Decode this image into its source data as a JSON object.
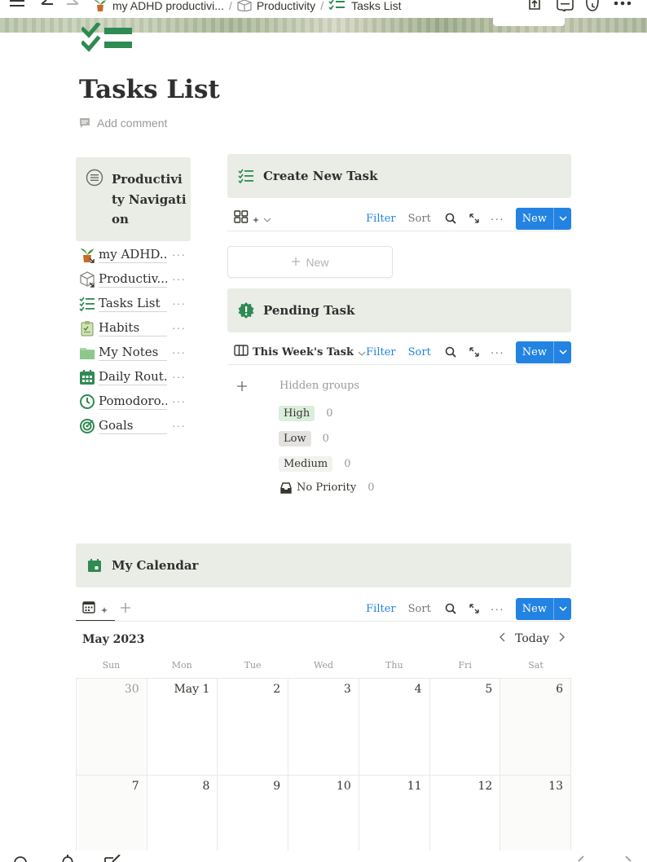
{
  "breadcrumb": {
    "items": [
      "my ADHD productivi...",
      "Productivity",
      "Tasks List"
    ],
    "separator": "/"
  },
  "page": {
    "title": "Tasks List",
    "add_comment": "Add comment"
  },
  "navigation": {
    "title": "Productivity Navigation",
    "items": [
      {
        "label": "my ADHD...",
        "icon": "potted-plant-icon"
      },
      {
        "label": "Productiv...",
        "icon": "cube-icon"
      },
      {
        "label": "Tasks List",
        "icon": "checklist-icon"
      },
      {
        "label": "Habits",
        "icon": "clipboard-icon"
      },
      {
        "label": "My Notes",
        "icon": "folder-icon"
      },
      {
        "label": "Daily Rout...",
        "icon": "calendar-icon"
      },
      {
        "label": "Pomodoro...",
        "icon": "clock-icon"
      },
      {
        "label": "Goals",
        "icon": "target-icon"
      }
    ],
    "more": "···"
  },
  "create_task": {
    "title": "Create New Task",
    "toolbar": {
      "filter": "Filter",
      "sort": "Sort",
      "new": "New",
      "more": "···"
    },
    "add_card": "New"
  },
  "pending_task": {
    "title": "Pending Task",
    "view_name": "This Week's Task",
    "toolbar": {
      "filter": "Filter",
      "sort": "Sort",
      "new": "New",
      "more": "···"
    },
    "hidden_groups": "Hidden groups",
    "groups": [
      {
        "label": "High",
        "count": "0"
      },
      {
        "label": "Low",
        "count": "0"
      },
      {
        "label": "Medium",
        "count": "0"
      },
      {
        "label": "No Priority",
        "count": "0"
      }
    ]
  },
  "calendar": {
    "title": "My Calendar",
    "toolbar": {
      "filter": "Filter",
      "sort": "Sort",
      "new": "New",
      "more": "···"
    },
    "month": "May 2023",
    "today": "Today",
    "weekdays": [
      "Sun",
      "Mon",
      "Tue",
      "Wed",
      "Thu",
      "Fri",
      "Sat"
    ],
    "days": [
      "30",
      "May 1",
      "2",
      "3",
      "4",
      "5",
      "6",
      "7",
      "8",
      "9",
      "10",
      "11",
      "12",
      "13"
    ]
  },
  "colors": {
    "accent": "#2383e2",
    "callout_bg": "#e9ede6",
    "icon_green": "#2f8a53",
    "tag_high": "#dbeddb",
    "tag_low": "#e3e2e0",
    "tag_medium": "#f1f1ef"
  }
}
